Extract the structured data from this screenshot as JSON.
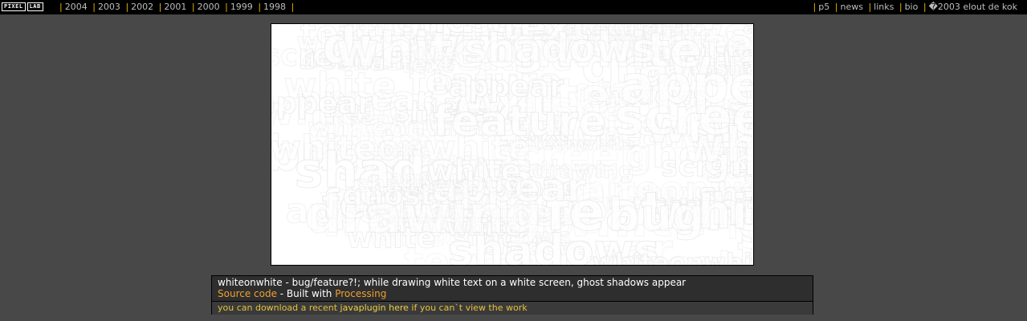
{
  "logo": {
    "left": "PIXEL",
    "right": "LAB"
  },
  "nav_left": [
    "2004",
    "2003",
    "2002",
    "2001",
    "2000",
    "1999",
    "1998"
  ],
  "nav_right": [
    "p5",
    "news",
    "links",
    "bio",
    "�2003 elout de kok"
  ],
  "canvas": {
    "ghost_words": [
      "whiteonwhite",
      "bug",
      "feature",
      "ghost",
      "shadows",
      "white",
      "text",
      "screen",
      "drawing",
      "appear"
    ]
  },
  "info": {
    "description": "whiteonwhite - bug/feature?!; while drawing white text on a white screen, ghost shadows appear",
    "source_link": "Source code",
    "built_with_text": " - Built with ",
    "processing_link": "Processing",
    "download_pre": "you can download a recent ",
    "javaplugin_link": "javaplugin here",
    "download_post": " if you can`t view the work"
  },
  "colors": {
    "background": "#484848",
    "topbar": "#000000",
    "separator": "#e6b800",
    "link_orange": "#f0a030",
    "link_yellow": "#f0d040"
  }
}
